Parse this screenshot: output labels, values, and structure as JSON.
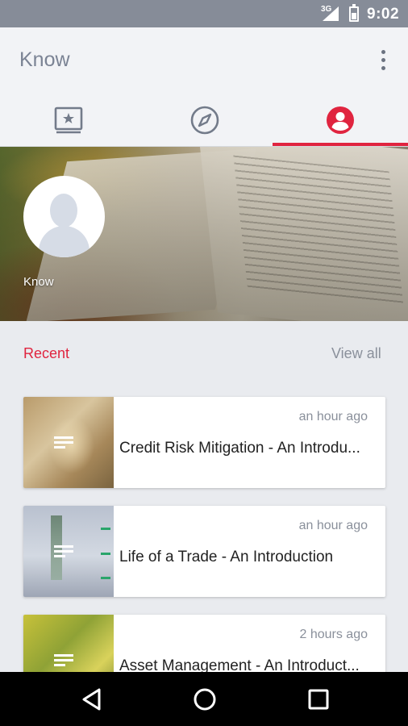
{
  "status_bar": {
    "network": "3G",
    "time": "9:02"
  },
  "app_bar": {
    "title": "Know",
    "overflow_icon": "more-vert-icon"
  },
  "tabs": [
    {
      "icon": "starred-book-icon",
      "selected": false
    },
    {
      "icon": "compass-icon",
      "selected": false
    },
    {
      "icon": "profile-icon",
      "selected": true
    }
  ],
  "profile": {
    "name": "Know"
  },
  "recent": {
    "label": "Recent",
    "view_all": "View all",
    "items": [
      {
        "time": "an hour ago",
        "title": "Credit Risk Mitigation - An Introdu..."
      },
      {
        "time": "an hour ago",
        "title": "Life of a Trade - An Introduction"
      },
      {
        "time": "2 hours ago",
        "title": "Asset Management - An Introduct..."
      }
    ]
  },
  "colors": {
    "accent": "#e0243f",
    "app_bar_bg": "#f2f3f6",
    "status_bar_bg": "#868c98",
    "page_bg": "#e9ebef"
  }
}
